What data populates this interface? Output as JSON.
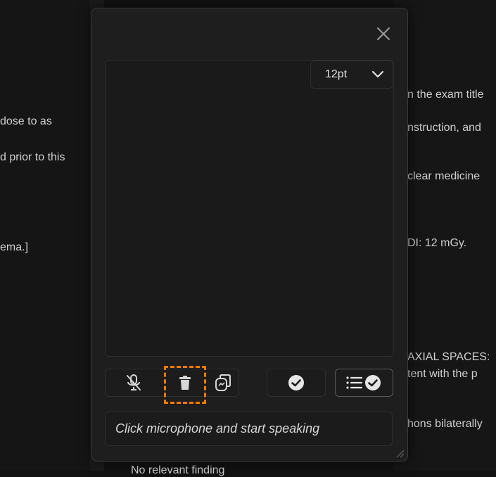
{
  "background": {
    "left_lines": [
      "dose to as",
      "d prior to this",
      "ema.]"
    ],
    "right_lines": [
      "n the exam title",
      "nstruction, and",
      "clear medicine",
      "DI: 12 mGy.",
      "AXIAL SPACES:",
      "tent with the p",
      "hons bilaterally"
    ],
    "bottom_line": "No relevant finding"
  },
  "modal": {
    "close_icon": "close-icon",
    "font_size": {
      "selected": "12pt",
      "icon": "chevron-down-icon"
    },
    "editor": {
      "value": ""
    },
    "toolbar": {
      "mute_mic_icon": "microphone-off-icon",
      "delete_icon": "trash-icon",
      "copy_icon": "copy-icon",
      "accept_icon": "check-circle-icon",
      "list_accept_icon": "list-check-icon"
    },
    "status_text": "Click microphone and start speaking"
  },
  "colors": {
    "accent_highlight": "#ff7a00",
    "modal_bg": "#1e1e1e"
  }
}
